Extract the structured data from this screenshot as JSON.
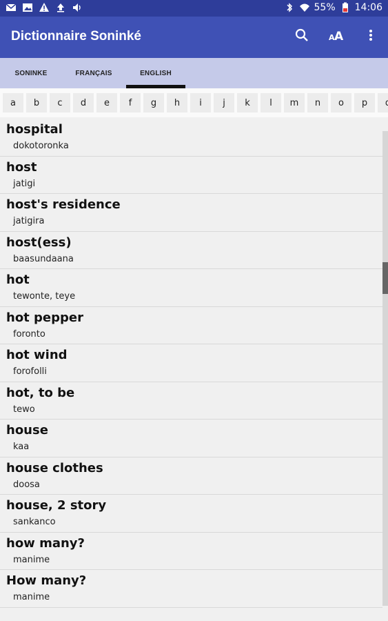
{
  "status": {
    "battery": "55%",
    "time": "14:06"
  },
  "app": {
    "title": "Dictionnaire Soninké"
  },
  "tabs": [
    {
      "label": "SONINKE",
      "active": false
    },
    {
      "label": "FRANÇAIS",
      "active": false
    },
    {
      "label": "ENGLISH",
      "active": true
    }
  ],
  "alphabet": [
    "a",
    "b",
    "c",
    "d",
    "e",
    "f",
    "g",
    "h",
    "i",
    "j",
    "k",
    "l",
    "m",
    "n",
    "o",
    "p",
    "q"
  ],
  "entries": [
    {
      "word": "hospital",
      "def": "dokotoronka"
    },
    {
      "word": "host",
      "def": "jatigi"
    },
    {
      "word": "host's residence",
      "def": "jatigira"
    },
    {
      "word": "host(ess)",
      "def": "baasundaana"
    },
    {
      "word": "hot",
      "def": "tewonte, teye"
    },
    {
      "word": "hot pepper",
      "def": "foronto"
    },
    {
      "word": "hot wind",
      "def": "forofolli"
    },
    {
      "word": "hot, to be",
      "def": "tewo"
    },
    {
      "word": "house",
      "def": "kaa"
    },
    {
      "word": "house clothes",
      "def": "doosa"
    },
    {
      "word": "house, 2 story",
      "def": "sankanco"
    },
    {
      "word": "how many?",
      "def": "manime"
    },
    {
      "word": "How many?",
      "def": "manime"
    }
  ],
  "colors": {
    "appbar": "#3f51b5",
    "statusbar": "#2e3d9a",
    "tabbar": "#c5cae9"
  }
}
